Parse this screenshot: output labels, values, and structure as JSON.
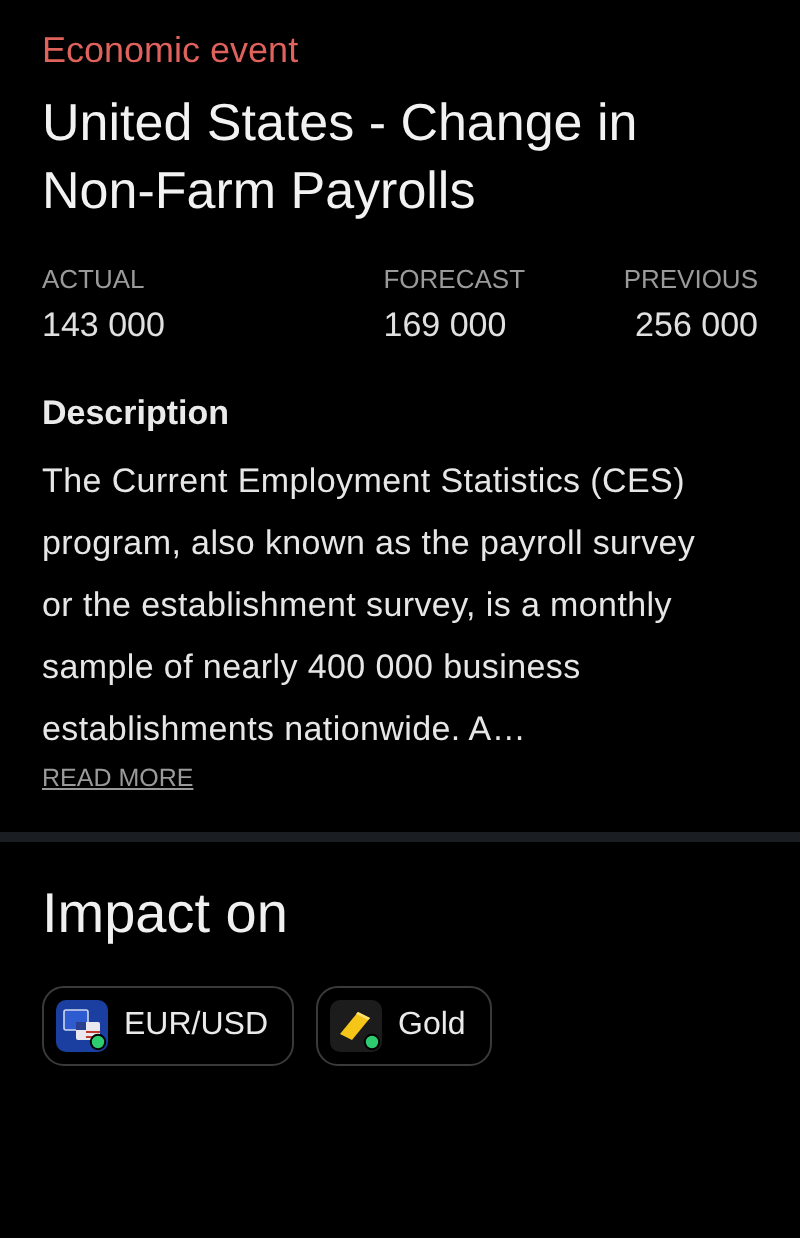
{
  "category": "Economic event",
  "title": "United States - Change in Non-Farm Payrolls",
  "stats": [
    {
      "label": "ACTUAL",
      "value": "143 000"
    },
    {
      "label": "FORECAST",
      "value": "169 000"
    },
    {
      "label": "PREVIOUS",
      "value": "256 000"
    }
  ],
  "description": {
    "heading": "Description",
    "text": "The Current Employment Statistics (CES) program, also known as the payroll survey or the establishment survey, is a monthly sample of nearly 400 000 business establishments nationwide. A…",
    "link": "READ MORE"
  },
  "impact": {
    "heading": "Impact on",
    "assets": [
      {
        "kind": "currency-pair",
        "label": "EUR/USD"
      },
      {
        "kind": "gold",
        "label": "Gold"
      }
    ]
  }
}
